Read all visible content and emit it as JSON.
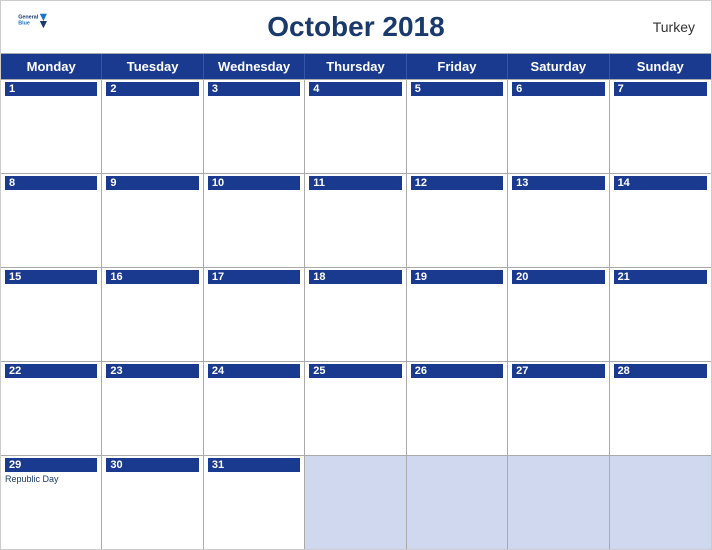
{
  "header": {
    "title": "October 2018",
    "country": "Turkey",
    "logo": {
      "line1": "General",
      "line2": "Blue"
    }
  },
  "days": {
    "headers": [
      "Monday",
      "Tuesday",
      "Wednesday",
      "Thursday",
      "Friday",
      "Saturday",
      "Sunday"
    ]
  },
  "weeks": [
    {
      "cells": [
        {
          "date": "1",
          "empty": false
        },
        {
          "date": "2",
          "empty": false
        },
        {
          "date": "3",
          "empty": false
        },
        {
          "date": "4",
          "empty": false
        },
        {
          "date": "5",
          "empty": false
        },
        {
          "date": "6",
          "empty": false
        },
        {
          "date": "7",
          "empty": false
        }
      ]
    },
    {
      "cells": [
        {
          "date": "8",
          "empty": false
        },
        {
          "date": "9",
          "empty": false
        },
        {
          "date": "10",
          "empty": false
        },
        {
          "date": "11",
          "empty": false
        },
        {
          "date": "12",
          "empty": false
        },
        {
          "date": "13",
          "empty": false
        },
        {
          "date": "14",
          "empty": false
        }
      ]
    },
    {
      "cells": [
        {
          "date": "15",
          "empty": false
        },
        {
          "date": "16",
          "empty": false
        },
        {
          "date": "17",
          "empty": false
        },
        {
          "date": "18",
          "empty": false
        },
        {
          "date": "19",
          "empty": false
        },
        {
          "date": "20",
          "empty": false
        },
        {
          "date": "21",
          "empty": false
        }
      ]
    },
    {
      "cells": [
        {
          "date": "22",
          "empty": false
        },
        {
          "date": "23",
          "empty": false
        },
        {
          "date": "24",
          "empty": false
        },
        {
          "date": "25",
          "empty": false
        },
        {
          "date": "26",
          "empty": false
        },
        {
          "date": "27",
          "empty": false
        },
        {
          "date": "28",
          "empty": false
        }
      ]
    },
    {
      "cells": [
        {
          "date": "29",
          "empty": false,
          "holiday": "Republic Day"
        },
        {
          "date": "30",
          "empty": false
        },
        {
          "date": "31",
          "empty": false
        },
        {
          "date": "",
          "empty": true
        },
        {
          "date": "",
          "empty": true
        },
        {
          "date": "",
          "empty": true
        },
        {
          "date": "",
          "empty": true
        }
      ]
    }
  ],
  "colors": {
    "header_bg": "#1a3a8f",
    "accent": "#1a75c8",
    "title_color": "#1a3a6b",
    "empty_cell": "#d0d8f0"
  }
}
